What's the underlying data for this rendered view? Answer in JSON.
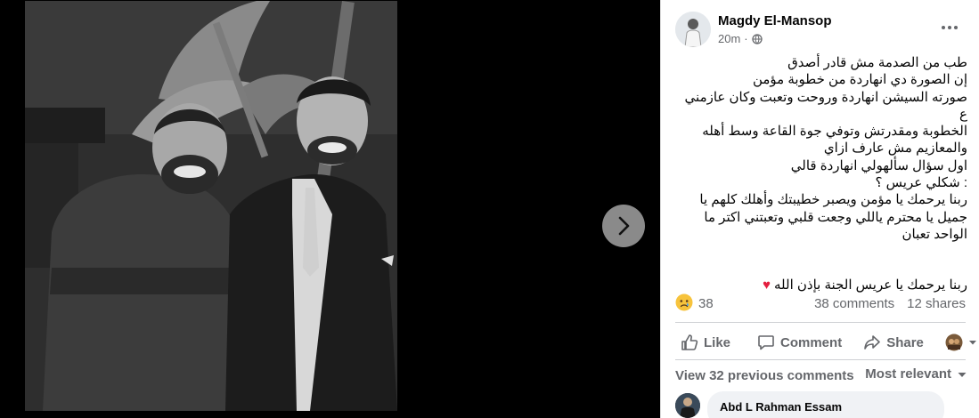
{
  "post": {
    "author": "Magdy El-Mansop",
    "time": "20m",
    "privacy_icon": "globe-icon",
    "lines": [
      "طب من الصدمة مش قادر أصدق",
      "إن الصورة دي انهاردة من خطوبة مؤمن",
      "صورته السيشن انهاردة وروحت وتعبت وكان عازمني ع",
      "الخطوبة ومقدرتش وتوفي جوة القاعة وسط أهله",
      "والمعازيم مش عارف ازاي",
      "اول سؤال سألهولي انهاردة قالي",
      ": شكلي عريس ؟",
      "ربنا يرحمك يا مؤمن ويصبر خطيبتك وأهلك كلهم يا",
      "جميل يا محترم ياللي وجعت قلبي وتعبتني اكتر ما",
      "الواحد تعبان"
    ],
    "closing_line": "ربنا يرحمك يا عريس الجنة بإذن الله",
    "closing_emoji": "♥"
  },
  "stats": {
    "reaction_icon": "sad-reaction-icon",
    "reaction_count": "38",
    "comments": "38 comments",
    "shares": "12 shares"
  },
  "actions": {
    "like": "Like",
    "comment": "Comment",
    "share": "Share"
  },
  "comments_section": {
    "view_previous": "View 32 previous comments",
    "sort": "Most relevant",
    "first_comment_author": "Abd L Rahman Essam"
  },
  "colors": {
    "accent_grey": "#65676b",
    "heart": "#e41e3f",
    "bubble": "#f0f2f5"
  }
}
